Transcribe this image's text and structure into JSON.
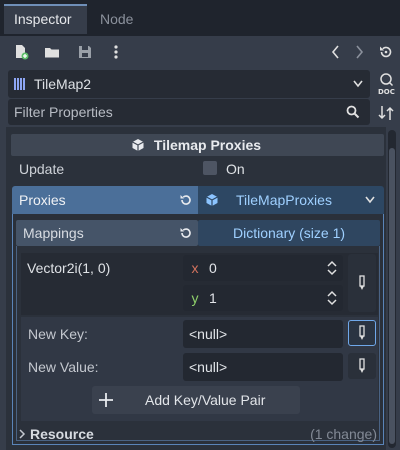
{
  "tabs": [
    {
      "label": "Inspector",
      "active": true
    },
    {
      "label": "Node",
      "active": false
    }
  ],
  "toolbar": {
    "icons": [
      "new-resource-icon",
      "open-folder-icon",
      "save-icon",
      "more-vert-icon",
      "back-icon",
      "forward-icon",
      "history-icon"
    ]
  },
  "object_selector": {
    "name": "TileMap2",
    "icon": "tilemap-icon"
  },
  "filter": {
    "placeholder": "Filter Properties"
  },
  "section": {
    "title": "Tilemap Proxies",
    "icon": "cube-icon"
  },
  "update": {
    "label": "Update",
    "checkbox_label": "On",
    "checked": false
  },
  "proxies": {
    "label": "Proxies",
    "value": "TileMapProxies"
  },
  "mappings": {
    "label": "Mappings",
    "value": "Dictionary (size 1)"
  },
  "entry": {
    "key_label": "Vector2i(1, 0)",
    "x_axis": "x",
    "x_value": "0",
    "y_axis": "y",
    "y_value": "1"
  },
  "new_key": {
    "label": "New Key:",
    "value": "<null>"
  },
  "new_value": {
    "label": "New Value:",
    "value": "<null>"
  },
  "add_pair": {
    "label": "Add Key/Value Pair"
  },
  "resource": {
    "label": "Resource",
    "changes": "(1 change)"
  },
  "colors": {
    "accent": "#5a84b8",
    "axis_x": "#d4735e",
    "axis_y": "#8fd16b"
  }
}
